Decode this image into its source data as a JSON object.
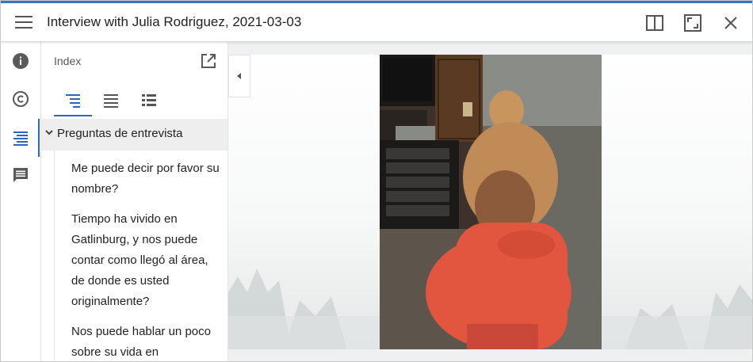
{
  "header": {
    "title": "Interview with Julia Rodriguez, 2021-03-03",
    "icons": [
      "menu-icon",
      "split-view-icon",
      "fullscreen-icon",
      "close-icon"
    ]
  },
  "side_rail": {
    "items": [
      {
        "name": "info-icon",
        "active": false
      },
      {
        "name": "copyright-icon",
        "active": false
      },
      {
        "name": "index-icon",
        "active": true
      },
      {
        "name": "comments-icon",
        "active": false
      }
    ]
  },
  "index_panel": {
    "title": "Index",
    "view_tabs": [
      {
        "name": "index-view-icon",
        "active": true
      },
      {
        "name": "transcript-view-icon",
        "active": false
      },
      {
        "name": "list-view-icon",
        "active": false
      }
    ],
    "section_label": "Preguntas de entrevista",
    "questions": [
      "Me puede decir por favor su nombre?",
      "Tiempo ha vivido en Gatlinburg, y nos puede contar como llegó al área, de donde es usted originalmente?",
      "Nos puede hablar un poco sobre su vida en"
    ]
  },
  "colors": {
    "accent": "#2a66c4",
    "shirt": "#e2553f",
    "icon_gray": "#5a5a5a"
  }
}
